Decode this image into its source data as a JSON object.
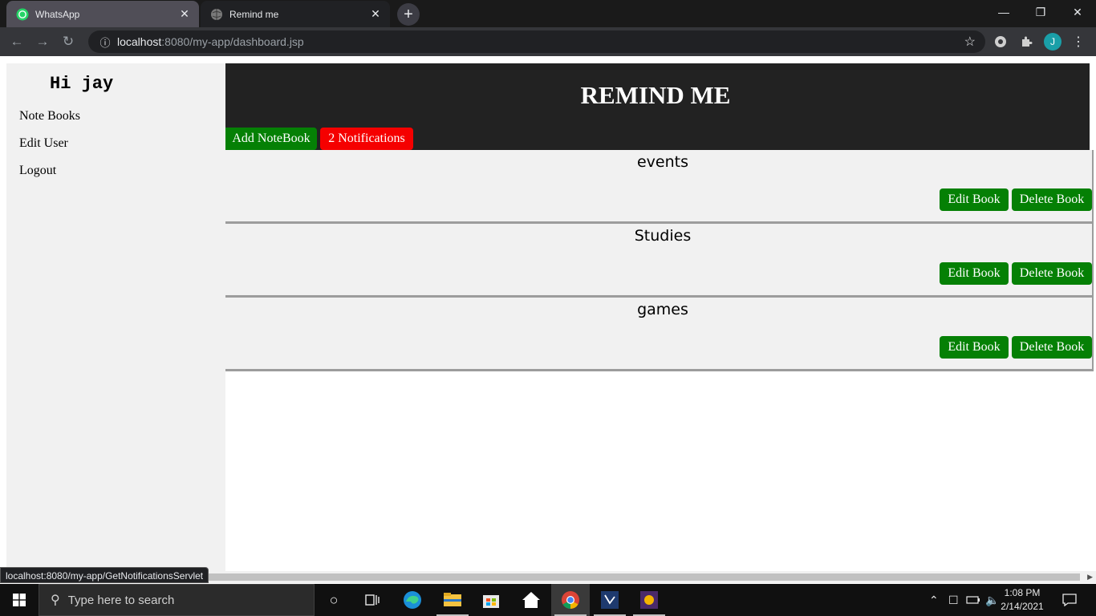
{
  "browser": {
    "tabs": [
      {
        "title": "WhatsApp",
        "icon": "whatsapp-icon"
      },
      {
        "title": "Remind me",
        "icon": "globe-icon"
      }
    ],
    "url_host": "localhost",
    "url_rest": ":8080/my-app/dashboard.jsp",
    "profile_initial": "J",
    "status_url": "localhost:8080/my-app/GetNotificationsServlet"
  },
  "sidebar": {
    "greeting": "Hi jay",
    "links": [
      "Note Books",
      "Edit User",
      "Logout"
    ]
  },
  "header": {
    "title": "REMIND ME",
    "add_notebook": "Add NoteBook",
    "notifications": "2 Notifications"
  },
  "notebooks": [
    {
      "name": "events",
      "edit_label": "Edit Book",
      "delete_label": "Delete Book"
    },
    {
      "name": "Studies",
      "edit_label": "Edit Book",
      "delete_label": "Delete Book"
    },
    {
      "name": "games",
      "edit_label": "Edit Book",
      "delete_label": "Delete Book"
    }
  ],
  "taskbar": {
    "search_placeholder": "Type here to search",
    "time": "1:08 PM",
    "date": "2/14/2021"
  },
  "colors": {
    "header_bg": "#222222",
    "green_button": "#058005",
    "red_button": "#f50000",
    "panel_bg": "#f1f1f1"
  }
}
